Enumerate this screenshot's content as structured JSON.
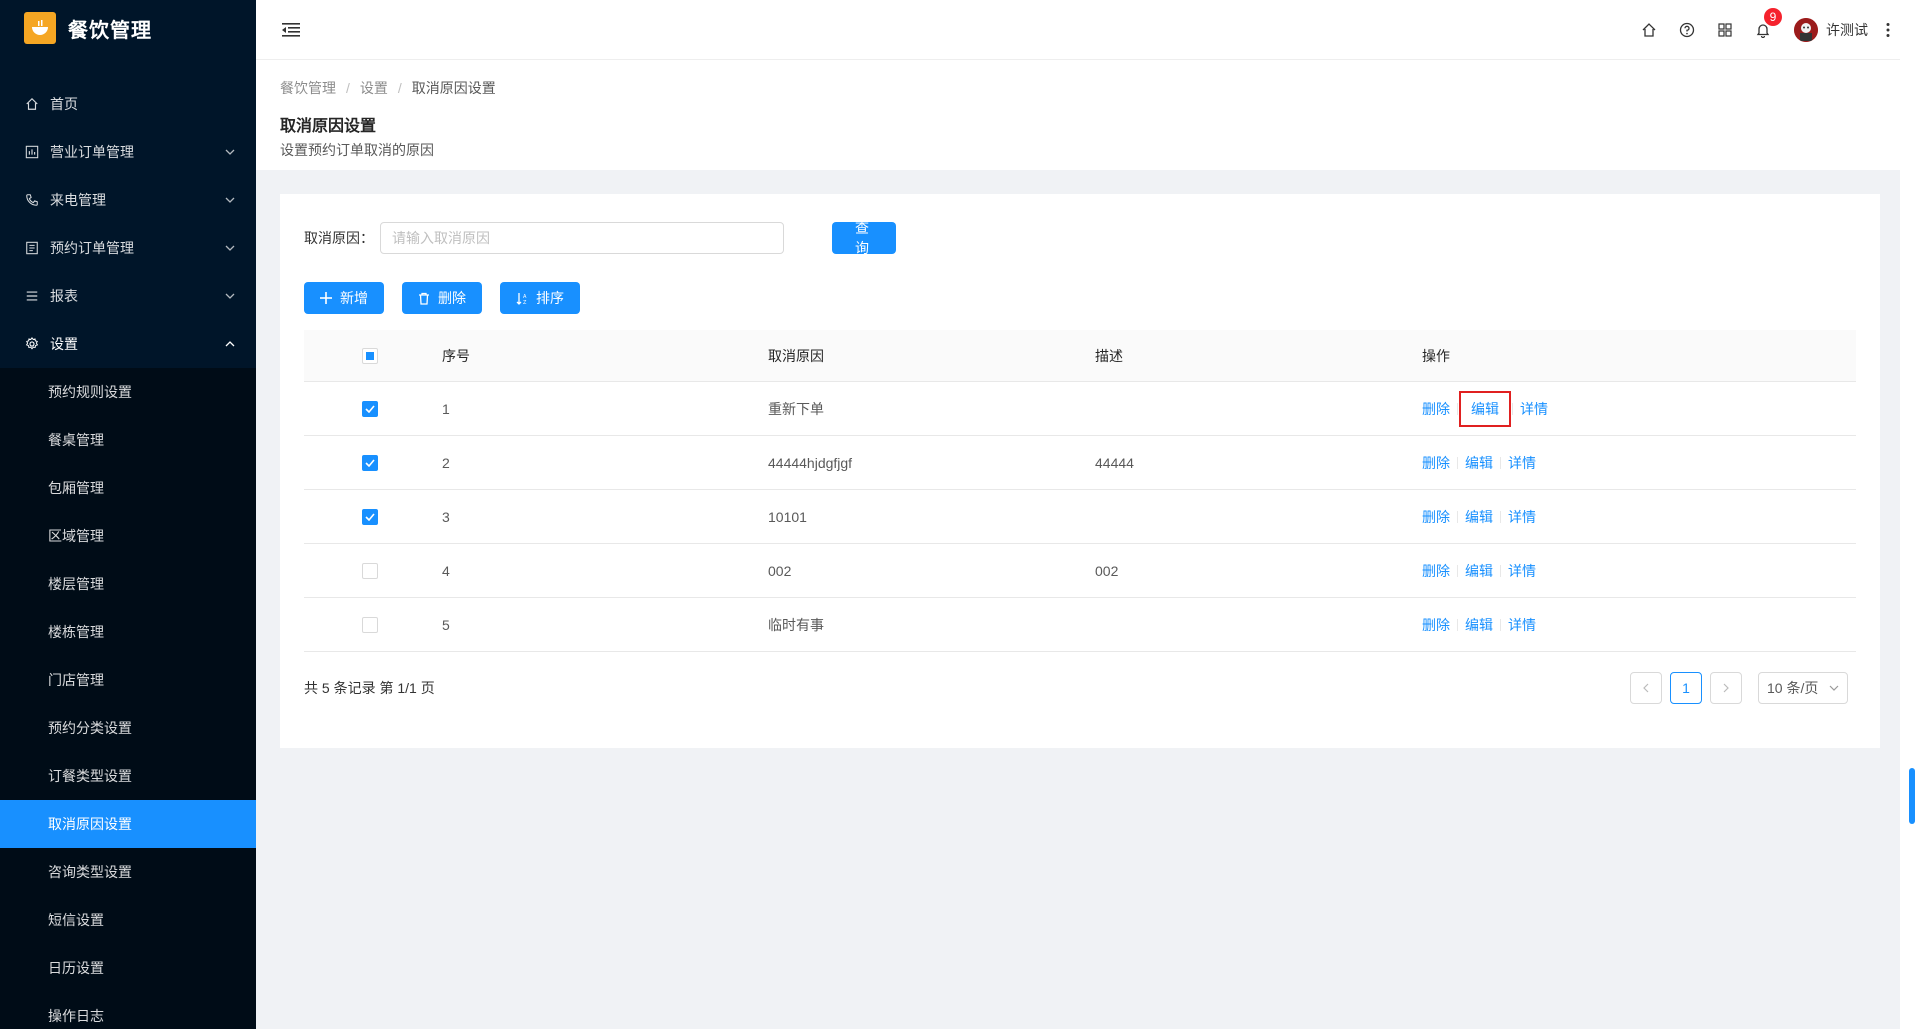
{
  "app": {
    "title": "餐饮管理",
    "logo_icon": "bowl-icon",
    "brand_color": "#1890ff"
  },
  "sidebar": {
    "items": [
      {
        "label": "首页",
        "icon": "home-icon",
        "has_arrow": false
      },
      {
        "label": "营业订单管理",
        "icon": "chart-icon",
        "has_arrow": true
      },
      {
        "label": "来电管理",
        "icon": "phone-icon",
        "has_arrow": true
      },
      {
        "label": "预约订单管理",
        "icon": "list-icon",
        "has_arrow": true
      },
      {
        "label": "报表",
        "icon": "menu-icon",
        "has_arrow": true
      },
      {
        "label": "设置",
        "icon": "gear-icon",
        "has_arrow": true,
        "open": true
      }
    ],
    "sub_items": [
      {
        "label": "预约规则设置"
      },
      {
        "label": "餐桌管理"
      },
      {
        "label": "包厢管理"
      },
      {
        "label": "区域管理"
      },
      {
        "label": "楼层管理"
      },
      {
        "label": "楼栋管理"
      },
      {
        "label": "门店管理"
      },
      {
        "label": "预约分类设置"
      },
      {
        "label": "订餐类型设置"
      },
      {
        "label": "取消原因设置",
        "active": true
      },
      {
        "label": "咨询类型设置"
      },
      {
        "label": "短信设置"
      },
      {
        "label": "日历设置"
      },
      {
        "label": "操作日志"
      }
    ]
  },
  "header": {
    "notification_count": "9",
    "user_name": "许测试",
    "icons": [
      "home-icon",
      "help-icon",
      "apps-icon",
      "bell-icon"
    ]
  },
  "breadcrumb": {
    "items": [
      "餐饮管理",
      "设置",
      "取消原因设置"
    ]
  },
  "page": {
    "title": "取消原因设置",
    "description": "设置预约订单取消的原因"
  },
  "search": {
    "label": "取消原因：",
    "placeholder": "请输入取消原因",
    "value": "",
    "query_button": "查询"
  },
  "toolbar": {
    "add_label": "新增",
    "delete_label": "删除",
    "sort_label": "排序"
  },
  "table": {
    "headers": [
      "序号",
      "取消原因",
      "描述",
      "操作"
    ],
    "header_check": "indeterminate",
    "rows": [
      {
        "checked": true,
        "no": "1",
        "reason": "重新下单",
        "desc": "",
        "highlight_edit": true
      },
      {
        "checked": true,
        "no": "2",
        "reason": "44444hjdgfjgf",
        "desc": "44444",
        "highlight_edit": false
      },
      {
        "checked": true,
        "no": "3",
        "reason": "10101",
        "desc": "",
        "highlight_edit": false
      },
      {
        "checked": false,
        "no": "4",
        "reason": "002",
        "desc": "002",
        "highlight_edit": false
      },
      {
        "checked": false,
        "no": "5",
        "reason": "临时有事",
        "desc": "",
        "highlight_edit": false
      }
    ],
    "ops": {
      "delete": "删除",
      "edit": "编辑",
      "detail": "详情"
    }
  },
  "footer": {
    "total_text": "共 5 条记录 第 1/1 页",
    "current_page": "1",
    "page_size": "10 条/页"
  }
}
